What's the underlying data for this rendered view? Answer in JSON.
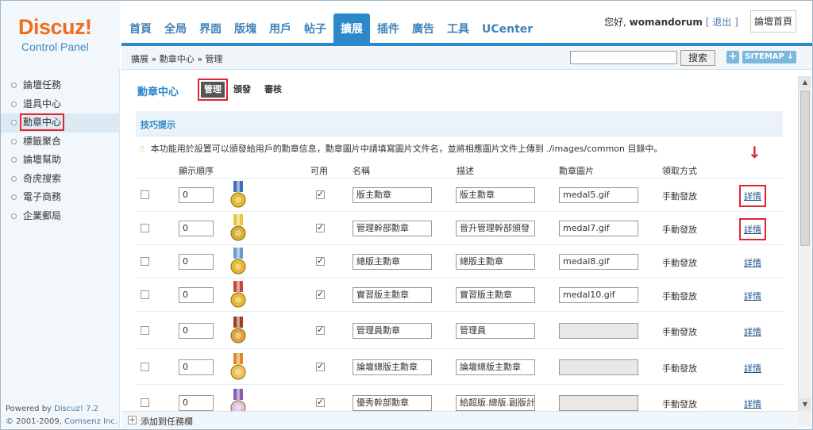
{
  "logo": {
    "title": "Discuz!",
    "subtitle": "Control Panel"
  },
  "nav": {
    "tabs": [
      "首頁",
      "全局",
      "界面",
      "版塊",
      "用戶",
      "帖子",
      "擴展",
      "插件",
      "廣告",
      "工具",
      "UCenter"
    ],
    "active_index": 6
  },
  "user": {
    "greeting": "您好,",
    "name": "womandorum",
    "logout": "[ 退出 ]",
    "home_button": "論壇首頁"
  },
  "breadcrumb": "擴展 » 勳章中心 » 管理",
  "search": {
    "button": "搜索",
    "value": ""
  },
  "sitemap": {
    "plus": "+",
    "label": "SITEMAP ↓"
  },
  "sidebar": {
    "items": [
      "論壇任務",
      "道具中心",
      "勳章中心",
      "標籤聚合",
      "論壇幫助",
      "奇虎搜索",
      "電子商務",
      "企業郵局"
    ],
    "active_index": 2,
    "powered_prefix": "Powered by ",
    "powered_name": "Discuz! 7.2",
    "copyright_prefix": "© 2001-2009, ",
    "copyright_link": "Comsenz Inc."
  },
  "main": {
    "title": "勳章中心",
    "subtabs": [
      "管理",
      "頒發",
      "審核"
    ],
    "tip_title": "技巧提示",
    "tip_text": "本功能用於設置可以頒發給用戶的勳章信息，勳章圖片中請填寫圖片文件名，並將相應圖片文件上傳到 ./images/common 目錄中。",
    "headers": {
      "order": "顯示順序",
      "enabled": "可用",
      "name": "名稱",
      "desc": "描述",
      "image": "勳章圖片",
      "method": "領取方式"
    },
    "rows": [
      {
        "order": "0",
        "enabled": true,
        "name": "版主勳章",
        "desc": "版主勳章",
        "image": "medal5.gif",
        "method": "手動發放",
        "action": "詳情"
      },
      {
        "order": "0",
        "enabled": true,
        "name": "管理幹部勳章",
        "desc": "晉升管理幹部頒發",
        "image": "medal7.gif",
        "method": "手動發放",
        "action": "詳情"
      },
      {
        "order": "0",
        "enabled": true,
        "name": "總版主勳章",
        "desc": "總版主勳章",
        "image": "medal8.gif",
        "method": "手動發放",
        "action": "詳情"
      },
      {
        "order": "0",
        "enabled": true,
        "name": "實習版主勳章",
        "desc": "實習版主勳章",
        "image": "medal10.gif",
        "method": "手動發放",
        "action": "詳情"
      },
      {
        "order": "0",
        "enabled": true,
        "name": "管理員勳章",
        "desc": "管理員",
        "image": "",
        "method": "手動發放",
        "action": "詳情"
      },
      {
        "order": "0",
        "enabled": true,
        "name": "論壇總版主勳章",
        "desc": "論壇總版主勳章",
        "image": "",
        "method": "手動發放",
        "action": "詳情"
      },
      {
        "order": "0",
        "enabled": true,
        "name": "優秀幹部勳章",
        "desc": "給超版.總版.副版計",
        "image": "",
        "method": "手動發放",
        "action": "詳情"
      }
    ]
  },
  "bottom": {
    "add_label": "添加到任務欄",
    "plus": "+"
  },
  "colors": {
    "accent": "#2c88c9",
    "logo_orange": "#f26c1a",
    "highlight_red": "#e0252e"
  }
}
